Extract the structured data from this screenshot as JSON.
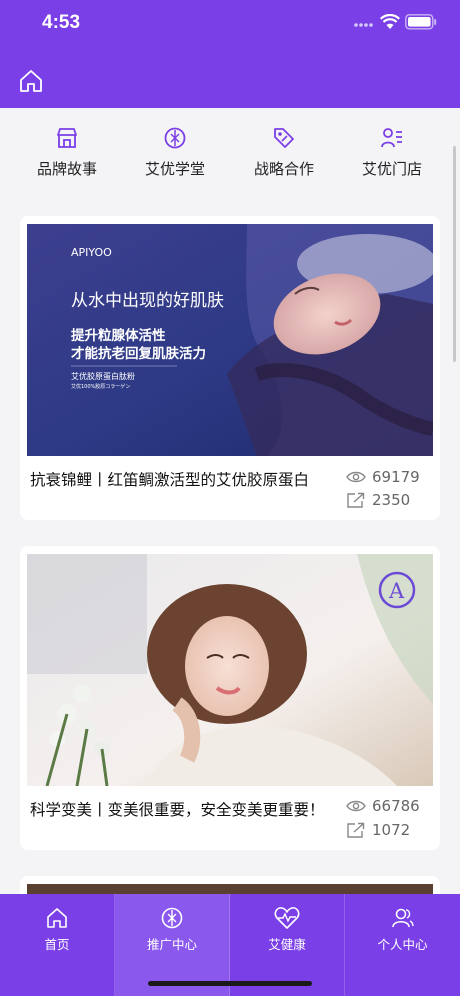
{
  "status_bar": {
    "time": "4:53"
  },
  "nav": {
    "home_icon": "home-icon"
  },
  "quick_menu": [
    {
      "label": "品牌故事",
      "icon": "store-icon"
    },
    {
      "label": "艾优学堂",
      "icon": "compass-icon"
    },
    {
      "label": "战略合作",
      "icon": "tag-icon"
    },
    {
      "label": "艾优门店",
      "icon": "user-list-icon"
    }
  ],
  "articles": [
    {
      "title": "抗衰锦鲤丨红笛鲷激活型的艾优胶原蛋白",
      "views": "69179",
      "shares": "2350",
      "image_text": {
        "logo": "APIYOO",
        "headline": "从水中出现的好肌肤",
        "line1": "提升粒腺体活性",
        "line2": "才能抗老回复肌肤活力",
        "product": "艾优胶原蛋白肽粉",
        "product_sub": "艾优100%胶原コラーゲン"
      }
    },
    {
      "title": "科学变美丨变美很重要，安全变美更重要！",
      "views": "66786",
      "shares": "1072",
      "image_text": {
        "badge": "A"
      }
    }
  ],
  "tab_bar": [
    {
      "label": "首页",
      "icon": "home-icon",
      "active": false
    },
    {
      "label": "推广中心",
      "icon": "compass-icon",
      "active": true
    },
    {
      "label": "艾健康",
      "icon": "heart-pulse-icon",
      "active": false
    },
    {
      "label": "个人中心",
      "icon": "people-icon",
      "active": false
    }
  ],
  "colors": {
    "primary": "#7a3fe6",
    "active_tab": "#8a58ec",
    "background": "#f4f3f6"
  }
}
